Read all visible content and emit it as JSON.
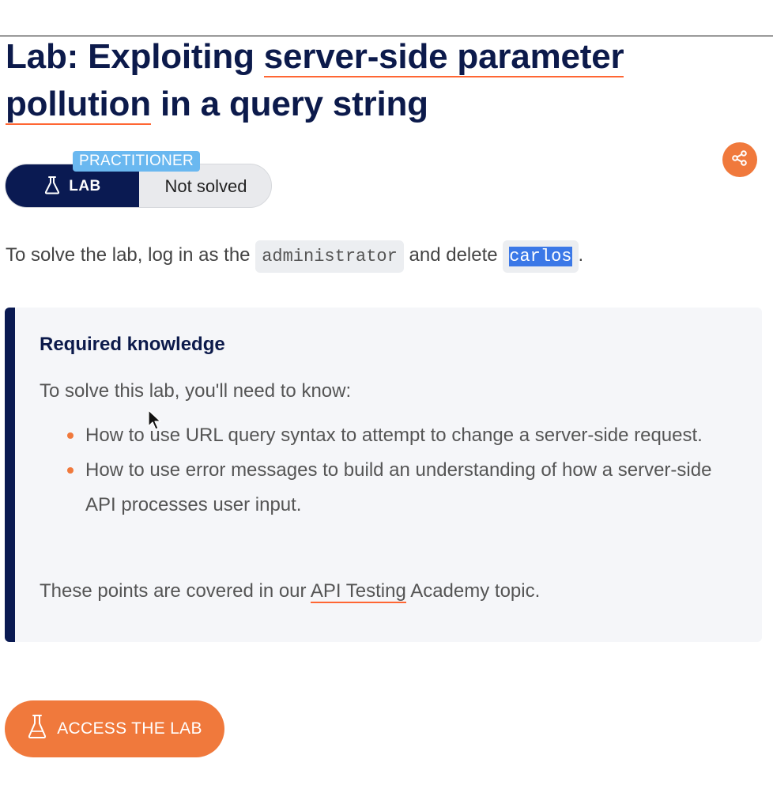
{
  "header": {
    "title_prefix": "Lab: Exploiting ",
    "title_link1": "server-side parameter",
    "title_link2": "pollution",
    "title_suffix": " in a query string"
  },
  "lab_badge": {
    "level": "PRACTITIONER",
    "type_label": "LAB",
    "status": "Not solved"
  },
  "share": {
    "icon": "share-icon"
  },
  "intro": {
    "text_before": "To solve the lab, log in as the ",
    "code1": "administrator",
    "text_middle": " and delete ",
    "code2": "carlos",
    "text_after": "."
  },
  "callout": {
    "title": "Required knowledge",
    "lead": "To solve this lab, you'll need to know:",
    "items": [
      "How to use URL query syntax to attempt to change a server-side request.",
      "How to use error messages to build an understanding of how a server-side API processes user input."
    ],
    "foot_before": "These points are covered in our ",
    "foot_link": "API Testing",
    "foot_after": " Academy topic."
  },
  "access": {
    "label": "ACCESS THE LAB",
    "icon": "flask-icon"
  },
  "colors": {
    "navy": "#0a1a52",
    "orange": "#f0793c",
    "practitioner_blue": "#6ab8f0",
    "selection_blue": "#3b78e7"
  }
}
